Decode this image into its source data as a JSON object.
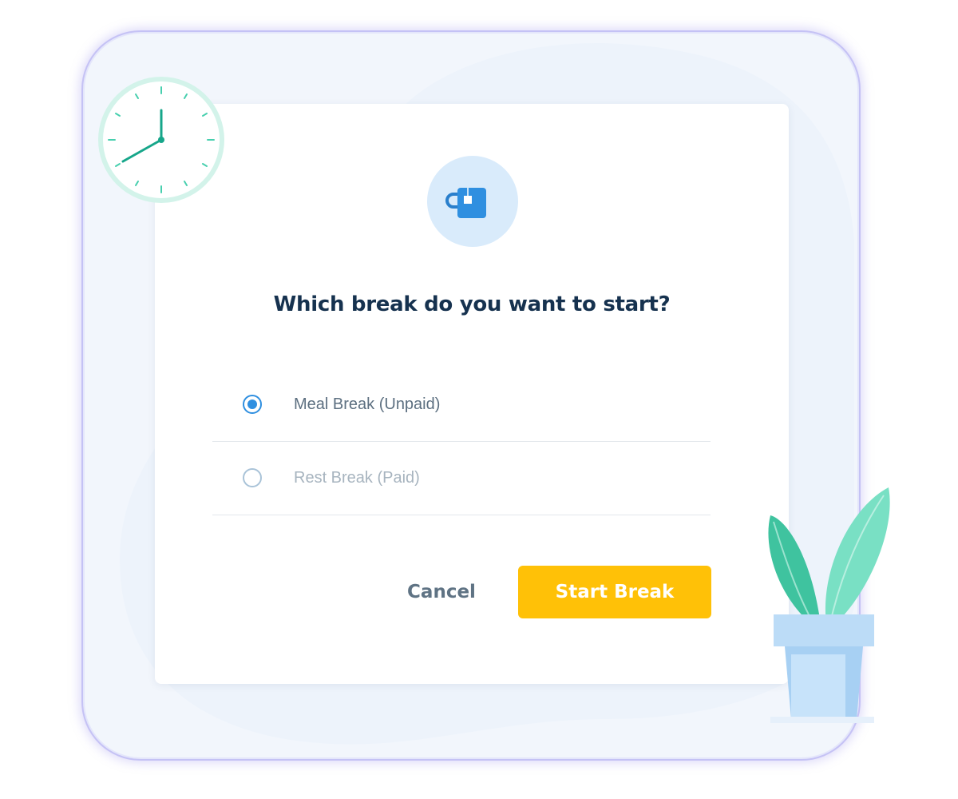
{
  "dialog": {
    "title": "Which break do you want to start?",
    "icon": "mug-icon",
    "options": [
      {
        "label": "Meal Break (Unpaid)",
        "selected": true
      },
      {
        "label": "Rest Break (Paid)",
        "selected": false
      }
    ],
    "cancel_label": "Cancel",
    "start_label": "Start Break"
  },
  "decorations": {
    "clock": "clock-icon",
    "plant": "plant-icon"
  },
  "colors": {
    "accent": "#2f8fe0",
    "primary_button": "#ffc107",
    "title": "#16324f",
    "teal": "#16a68a"
  }
}
